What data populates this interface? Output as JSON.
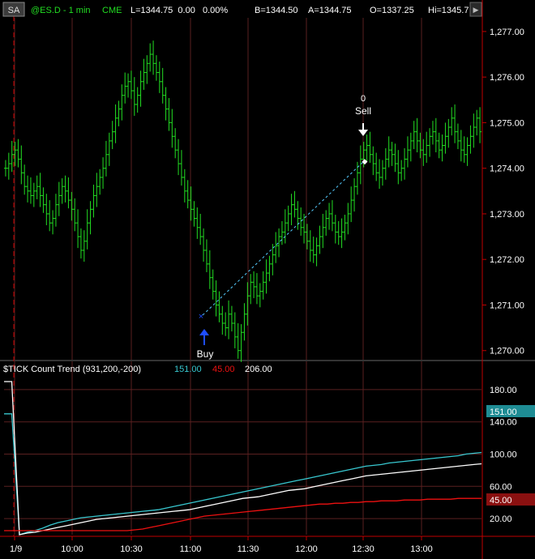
{
  "header": {
    "mode_button": "SA",
    "symbol": "@ES.D - 1 min",
    "exchange": "CME",
    "quote": "L=1344.75  0.00   0.00%",
    "bid": "B=1344.50",
    "ask": "A=1344.75",
    "open": "O=1337.25",
    "high": "Hi=1345.7",
    "scroll_right_label": "▶"
  },
  "indicator": {
    "name": "$TICK Count Trend (931,200,-200)",
    "value1": "151.00",
    "value2": "45.00",
    "value3": "206.00"
  },
  "colors": {
    "price_bar": "#22dd22",
    "cyan": "#38c8d0",
    "red": "#ee1111",
    "white": "#ffffff",
    "grid": "#5a2020",
    "buy_arrow": "#1e4dff",
    "sell_arrow": "#ffffff",
    "trade_line": "#55ccff"
  },
  "trades": {
    "buy_label": "Buy",
    "sell_label": "Sell",
    "sell_qty": "0"
  },
  "chart_data": [
    {
      "type": "bar",
      "title": "",
      "y_ticks": [
        "1,277.00",
        "1,276.00",
        "1,275.00",
        "1,274.00",
        "1,273.00",
        "1,272.00",
        "1,271.00",
        "1,270.00"
      ],
      "ylim": [
        1269.8,
        1277.3
      ],
      "x_ticks": [
        "1/9",
        "10:00",
        "10:30",
        "11:00",
        "11:30",
        "12:00",
        "12:30",
        "13:00"
      ],
      "closes": [
        1274.0,
        1274.1,
        1274.3,
        1274.4,
        1274.2,
        1273.9,
        1273.6,
        1273.5,
        1273.4,
        1273.5,
        1273.6,
        1273.4,
        1273.2,
        1273.0,
        1272.8,
        1272.9,
        1273.2,
        1273.4,
        1273.6,
        1273.5,
        1273.3,
        1273.1,
        1272.8,
        1272.5,
        1272.2,
        1272.4,
        1272.8,
        1273.1,
        1273.4,
        1273.6,
        1273.8,
        1274.0,
        1274.3,
        1274.6,
        1274.8,
        1275.1,
        1275.3,
        1275.6,
        1275.8,
        1275.9,
        1275.7,
        1275.4,
        1275.6,
        1275.9,
        1276.1,
        1276.3,
        1276.5,
        1276.3,
        1276.1,
        1275.9,
        1275.6,
        1275.3,
        1275.0,
        1274.7,
        1274.4,
        1274.1,
        1273.8,
        1273.5,
        1273.3,
        1273.1,
        1272.9,
        1272.7,
        1272.5,
        1272.2,
        1271.9,
        1271.6,
        1271.3,
        1271.0,
        1270.8,
        1270.6,
        1270.5,
        1270.8,
        1270.6,
        1270.3,
        1270.0,
        1270.4,
        1270.8,
        1271.2,
        1271.5,
        1271.4,
        1271.2,
        1271.3,
        1271.5,
        1271.7,
        1271.9,
        1272.1,
        1272.3,
        1272.5,
        1272.6,
        1272.8,
        1273.0,
        1273.2,
        1273.1,
        1272.9,
        1272.7,
        1272.6,
        1272.4,
        1272.2,
        1272.1,
        1272.3,
        1272.5,
        1272.7,
        1272.9,
        1273.0,
        1272.8,
        1272.6,
        1272.5,
        1272.6,
        1272.8,
        1273.0,
        1273.3,
        1273.6,
        1273.9,
        1274.2,
        1274.4,
        1274.5,
        1274.3,
        1274.1,
        1273.9,
        1273.8,
        1274.0,
        1274.2,
        1274.4,
        1274.3,
        1274.1,
        1273.9,
        1274.0,
        1274.2,
        1274.4,
        1274.6,
        1274.8,
        1274.6,
        1274.4,
        1274.3,
        1274.5,
        1274.7,
        1274.8,
        1274.6,
        1274.4,
        1274.5,
        1274.7,
        1274.9,
        1275.1,
        1274.8,
        1274.6,
        1274.4,
        1274.3,
        1274.5,
        1274.7,
        1274.9,
        1275.1,
        1274.8
      ]
    },
    {
      "type": "line",
      "y_ticks": [
        "180.00",
        "140.00",
        "100.00",
        "60.00",
        "20.00"
      ],
      "ylim": [
        0,
        195
      ],
      "last_value_tags": [
        "151.00",
        "45.00"
      ],
      "series": [
        {
          "color": "cyan",
          "values": [
            150,
            150,
            0,
            3,
            5,
            8,
            12,
            15,
            17,
            19,
            21,
            22,
            23,
            24,
            25,
            26,
            27,
            28,
            29,
            30,
            31,
            33,
            35,
            37,
            39,
            41,
            43,
            45,
            47,
            49,
            51,
            53,
            55,
            57,
            59,
            61,
            63,
            65,
            67,
            69,
            71,
            73,
            75,
            77,
            79,
            81,
            83,
            85,
            86,
            87,
            89,
            90,
            91,
            92,
            93,
            94,
            95,
            96,
            97,
            98,
            100,
            101,
            102
          ]
        },
        {
          "color": "white",
          "values": [
            190,
            190,
            0,
            2,
            3,
            5,
            7,
            9,
            11,
            13,
            15,
            17,
            19,
            20,
            21,
            22,
            23,
            24,
            25,
            26,
            27,
            28,
            29,
            30,
            31,
            33,
            35,
            37,
            39,
            41,
            43,
            45,
            46,
            47,
            49,
            51,
            53,
            55,
            56,
            57,
            59,
            61,
            63,
            65,
            67,
            69,
            71,
            73,
            74,
            75,
            76,
            77,
            78,
            79,
            80,
            81,
            82,
            83,
            84,
            85,
            86,
            87,
            88
          ]
        },
        {
          "color": "red",
          "values": [
            5,
            5,
            5,
            5,
            5,
            5,
            5,
            5,
            5,
            5,
            5,
            5,
            5,
            5,
            5,
            5,
            5,
            6,
            7,
            9,
            11,
            13,
            15,
            17,
            19,
            21,
            23,
            24,
            25,
            26,
            27,
            28,
            29,
            30,
            31,
            32,
            33,
            34,
            35,
            36,
            37,
            38,
            38,
            39,
            39,
            40,
            40,
            41,
            41,
            42,
            42,
            42,
            43,
            43,
            43,
            44,
            44,
            44,
            44,
            45,
            45,
            45,
            45
          ]
        }
      ]
    }
  ]
}
